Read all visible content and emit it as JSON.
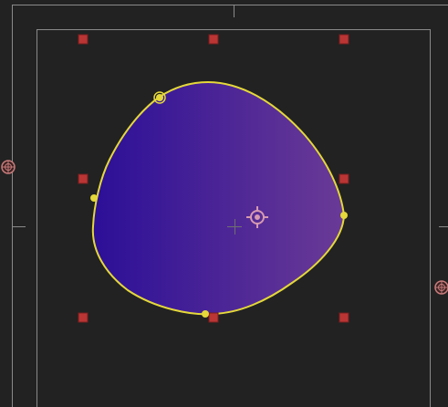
{
  "viewer": {
    "background": "#222222",
    "guide_color": "#8a8a8a",
    "center_marker_color": "#6f6f6f"
  },
  "shape": {
    "name": "blob-shape",
    "gradient_start": "#2b0f97",
    "gradient_end": "#6a3a96",
    "outline_color": "#e4d83a",
    "point_color": "#e4d83a"
  },
  "transform_handles": {
    "color": "#bb3535",
    "border": "#7a1d1d"
  },
  "pivot": {
    "icon": "crosshair-target-icon",
    "color": "#d69ab0"
  },
  "side_handles": {
    "icon": "rotate-handle-icon",
    "color": "#c97b7b"
  }
}
